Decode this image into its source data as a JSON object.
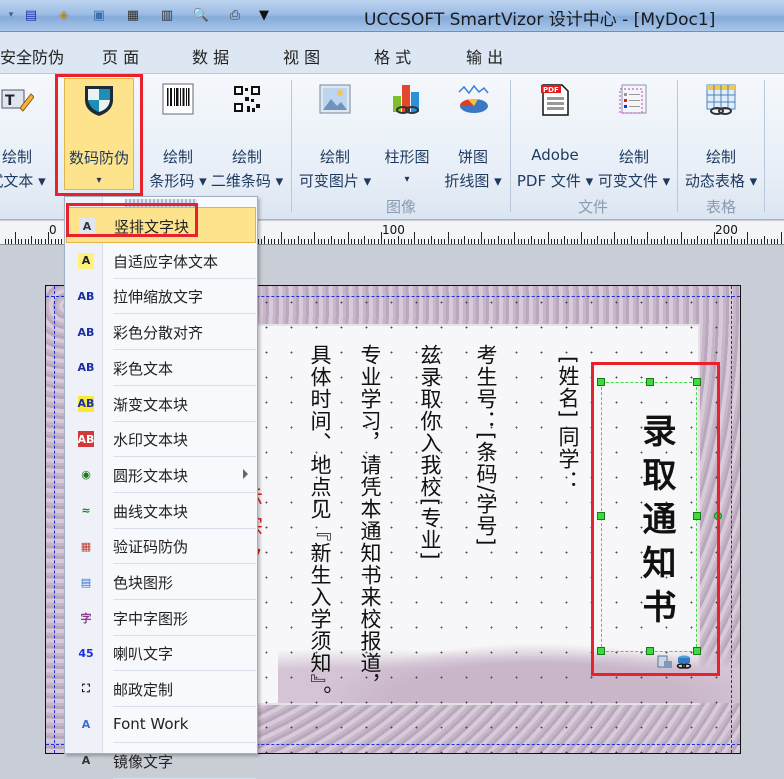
{
  "window": {
    "title": "UCCSOFT SmartVizor 设计中心 - [MyDoc1]"
  },
  "quick_access": [
    "page-setup-icon",
    "fill-icon",
    "select-all-icon",
    "layout-icon",
    "print-preview-icon",
    "zoom-preview-icon",
    "print-icon",
    "customize-qa-icon"
  ],
  "tabs": [
    {
      "label": "安全防伪",
      "active": false
    },
    {
      "label": "页 面",
      "active": true
    },
    {
      "label": "数 据",
      "active": false
    },
    {
      "label": "视 图",
      "active": false
    },
    {
      "label": "格 式",
      "active": false
    },
    {
      "label": "输 出",
      "active": false
    }
  ],
  "ribbon": {
    "buttons": [
      {
        "line1": "绘制",
        "line2": "式文本 ▾",
        "icon": "text-style-pencil-icon"
      },
      {
        "line1": "数码防伪",
        "line2": "▾",
        "icon": "shield-icon",
        "active": true
      },
      {
        "line1": "绘制",
        "line2": "条形码 ▾",
        "icon": "barcode-icon"
      },
      {
        "line1": "绘制",
        "line2": "二维条码 ▾",
        "icon": "qrcode-icon"
      },
      {
        "line1": "绘制",
        "line2": "可变图片 ▾",
        "icon": "image-icon"
      },
      {
        "line1": "柱形图",
        "line2": "▾",
        "icon": "bar-chart-icon"
      },
      {
        "line1": "饼图",
        "line2": "折线图 ▾",
        "icon": "pie-chart-icon"
      },
      {
        "line1": "Adobe",
        "line2": "PDF 文件 ▾",
        "icon": "pdf-icon"
      },
      {
        "line1": "绘制",
        "line2": "可变文件 ▾",
        "icon": "variable-file-icon"
      },
      {
        "line1": "绘制",
        "line2": "动态表格 ▾",
        "icon": "dynamic-table-icon"
      }
    ],
    "groups": [
      "图像",
      "文件",
      "表格"
    ]
  },
  "ruler": {
    "labels": [
      "0",
      "100",
      "200"
    ]
  },
  "menu": {
    "items": [
      {
        "label": "竖排文字块",
        "icon": "vertical-text-icon",
        "highlighted": true
      },
      {
        "label": "自适应字体文本",
        "icon": "autofit-text-icon"
      },
      {
        "label": "拉伸缩放文字",
        "icon": "stretch-text-icon"
      },
      {
        "label": "彩色分散对齐",
        "icon": "color-justify-icon"
      },
      {
        "label": "彩色文本",
        "icon": "color-text-icon"
      },
      {
        "label": "渐变文本块",
        "icon": "gradient-text-icon"
      },
      {
        "label": "水印文本块",
        "icon": "watermark-text-icon"
      },
      {
        "label": "圆形文本块",
        "icon": "circle-text-icon",
        "submenu": true
      },
      {
        "label": "曲线文本块",
        "icon": "curve-text-icon"
      },
      {
        "label": "验证码防伪",
        "icon": "captcha-icon"
      },
      {
        "label": "色块图形",
        "icon": "color-block-icon"
      },
      {
        "label": "字中字图形",
        "icon": "text-in-text-icon"
      },
      {
        "label": "喇叭文字",
        "icon": "horn-text-icon"
      },
      {
        "label": "邮政定制",
        "icon": "postal-icon"
      },
      {
        "label": "Font Work",
        "icon": "fontwork-icon"
      },
      {
        "label": "镜像文字",
        "icon": "mirror-text-icon"
      }
    ]
  },
  "document": {
    "title_text": "录取通知书",
    "columns": [
      "[姓名]  同学：",
      "考生号：[条码/学号]",
      "兹录取你入我校[专业]",
      "专业学习，请凭本通知书来校报道，",
      "具体时间、地点见『新生入学须知』。"
    ]
  },
  "colors": {
    "highlight": "#fde38c",
    "annotation": "#e8212d",
    "guide": "#1a2ee0",
    "handle": "#3ddc3d"
  }
}
